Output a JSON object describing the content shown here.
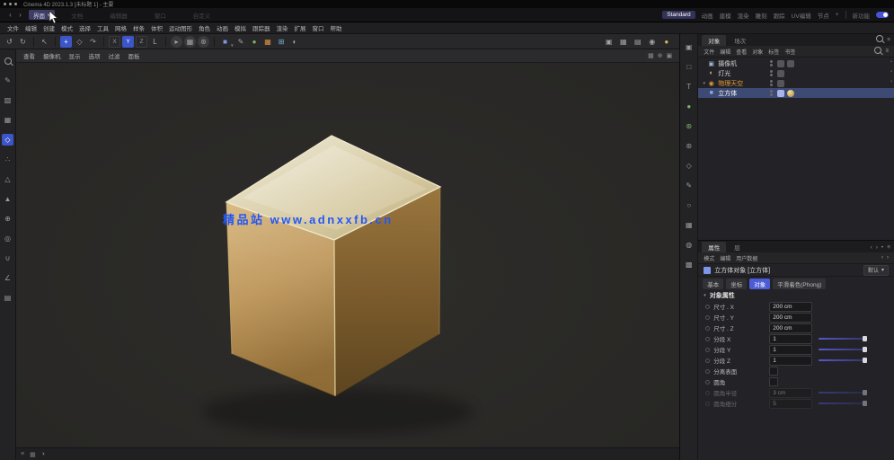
{
  "colors": {
    "accent": "#4b5cd6",
    "selection_row": "#3d4a73",
    "orange": "#e09a3c",
    "watermark_blue": "#2457f5",
    "viewport_bg": "#2b2a27",
    "cube_top": "#e9e2cc",
    "cube_left": "#c09a5b",
    "cube_right": "#7c5d2f"
  },
  "title_bar": {
    "title": "Cinema 4D 2023.1.3 [未标题 1] - 主要"
  },
  "top_bar": {
    "back": "‹",
    "forward": "›",
    "active_button_label": "界面",
    "active_button_caret": "▾",
    "menus": [
      "文档",
      "编辑器",
      "窗口",
      "自定义"
    ],
    "layout_tabs": [
      {
        "label": "Standard"
      },
      {
        "label": "动画"
      },
      {
        "label": "建模"
      },
      {
        "label": "渲染"
      },
      {
        "label": "雕刻"
      },
      {
        "label": "跟踪"
      },
      {
        "label": "UV编辑"
      },
      {
        "label": "节点"
      }
    ],
    "add_tab": "+",
    "new_features": "新功能"
  },
  "menu_bar": {
    "items": [
      "文件",
      "编辑",
      "创建",
      "模式",
      "选择",
      "工具",
      "网格",
      "样条",
      "体积",
      "运动图形",
      "角色",
      "动画",
      "模拟",
      "跟踪器",
      "渲染",
      "扩展",
      "窗口",
      "帮助"
    ]
  },
  "toolbar": {
    "undo": "↺",
    "redo": "↻",
    "select": "↖",
    "move": "+",
    "scale": "◇",
    "rotate": "↷",
    "axis_x": "X",
    "axis_y": "Y",
    "axis_z": "Z",
    "coord": "L",
    "render_view": "▸",
    "render_pv": "▦",
    "render_settings": "⊛",
    "cube": "■",
    "cube_caret": "▾",
    "pen": "✎",
    "subdiv": "●",
    "volume": "▦",
    "mograph": "⊞",
    "dynamics": "◐",
    "vp_single": "▣",
    "vp_quad": "▦",
    "vp_custom": "▤",
    "gpu": "◉",
    "material": "●"
  },
  "left_palette": {
    "items": [
      {
        "name": "viewport-filter",
        "glyph": ""
      },
      {
        "name": "convert-editable",
        "glyph": "✎"
      },
      {
        "name": "model-mode",
        "glyph": "▧"
      },
      {
        "name": "texture-mode",
        "glyph": "▦"
      },
      {
        "name": "workplane-mode",
        "glyph": "◇"
      },
      {
        "name": "points-mode",
        "glyph": "∴"
      },
      {
        "name": "edges-mode",
        "glyph": "△"
      },
      {
        "name": "polygons-mode",
        "glyph": "▲"
      },
      {
        "name": "enable-axis",
        "glyph": "⊕"
      },
      {
        "name": "viewport-solo",
        "glyph": "◎"
      },
      {
        "name": "snap",
        "glyph": "∪"
      },
      {
        "name": "quantize",
        "glyph": "∠"
      },
      {
        "name": "workplane",
        "glyph": "▤"
      }
    ]
  },
  "right_strip": {
    "items": [
      {
        "name": "camera",
        "glyph": "▣"
      },
      {
        "name": "plane",
        "glyph": "□"
      },
      {
        "name": "text",
        "glyph": "T"
      },
      {
        "name": "sphere",
        "glyph": "●"
      },
      {
        "name": "generator",
        "glyph": "⊛"
      },
      {
        "name": "settings",
        "glyph": "⊛"
      },
      {
        "name": "spline",
        "glyph": "◇"
      },
      {
        "name": "pen",
        "glyph": "✎"
      },
      {
        "name": "circle",
        "glyph": "○"
      },
      {
        "name": "grid",
        "glyph": "▦"
      },
      {
        "name": "globe",
        "glyph": "◍"
      },
      {
        "name": "checker",
        "glyph": "▩"
      }
    ]
  },
  "viewport": {
    "menus": [
      "查看",
      "摄像机",
      "显示",
      "选项",
      "过滤",
      "面板"
    ],
    "right_icons": [
      {
        "name": "grid-toggle",
        "glyph": "▦"
      },
      {
        "name": "axis-toggle",
        "glyph": "⊕"
      },
      {
        "name": "maximize",
        "glyph": "▣"
      }
    ],
    "watermark": "精品站 www.adnxxfb.cn"
  },
  "bottom_bar": {
    "icons": [
      {
        "name": "menu",
        "glyph": "≡"
      },
      {
        "name": "grid",
        "glyph": "▦"
      },
      {
        "name": "time",
        "glyph": "◑"
      }
    ]
  },
  "objects_panel": {
    "tabs": [
      {
        "label": "对象"
      },
      {
        "label": "场次"
      }
    ],
    "menus": [
      "文件",
      "编辑",
      "查看",
      "对象",
      "标签",
      "书签"
    ],
    "rows": [
      {
        "name": "摄像机",
        "glyph": "▣"
      },
      {
        "name": "灯光",
        "glyph": "◐"
      },
      {
        "name": "物理天空",
        "glyph": "◉"
      },
      {
        "name": "立方体",
        "glyph": "■"
      }
    ]
  },
  "attributes_panel": {
    "tabs": [
      {
        "label": "属性"
      },
      {
        "label": "层"
      }
    ],
    "menus": [
      "模式",
      "编辑",
      "用户数据"
    ],
    "object_title": "立方体对象 [立方体]",
    "preset": "默认",
    "section_tabs": [
      {
        "label": "基本"
      },
      {
        "label": "坐标"
      },
      {
        "label": "对象"
      },
      {
        "label": "平滑着色(Phong)"
      }
    ],
    "section_title": "对象属性",
    "params": [
      {
        "label": "尺寸 . X",
        "value": "200 cm"
      },
      {
        "label": "尺寸 . Y",
        "value": "200 cm"
      },
      {
        "label": "尺寸 . Z",
        "value": "200 cm"
      },
      {
        "label": "分段 X",
        "value": "1"
      },
      {
        "label": "分段 Y",
        "value": "1"
      },
      {
        "label": "分段 Z",
        "value": "1"
      },
      {
        "label": "分离表面",
        "value": ""
      },
      {
        "label": "圆角",
        "value": ""
      },
      {
        "label": "圆角半径",
        "value": "3 cm"
      },
      {
        "label": "圆角细分",
        "value": "5"
      }
    ]
  }
}
